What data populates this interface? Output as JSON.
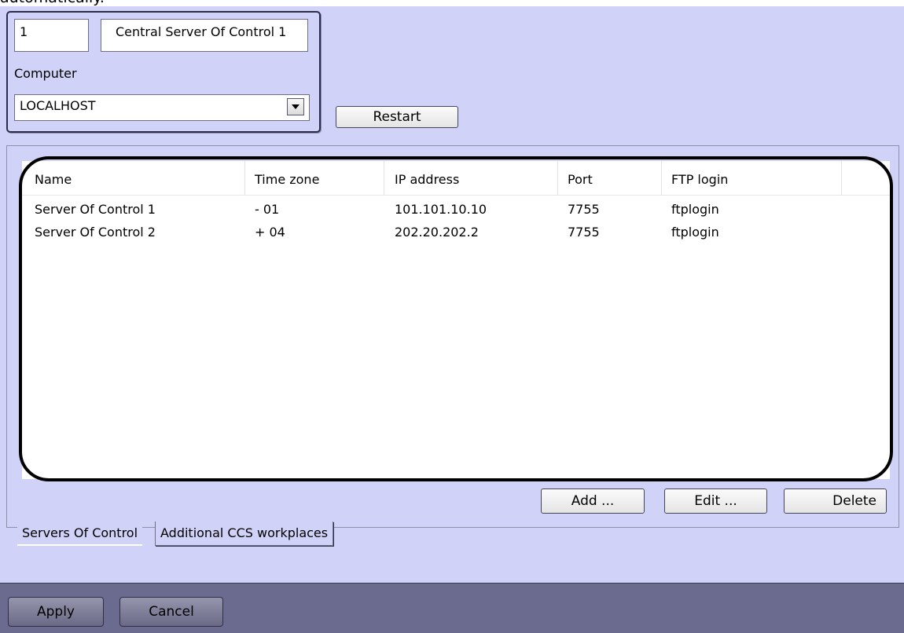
{
  "caption": "automatically.",
  "object": {
    "id": "1",
    "name": "Central Server Of Control 1",
    "computer_label": "Computer",
    "computer_value": "LOCALHOST",
    "restart_label": "Restart"
  },
  "table": {
    "columns": [
      "Name",
      "Time zone",
      "IP address",
      "Port",
      "FTP login"
    ],
    "rows": [
      [
        "Server Of Control 1",
        "- 01",
        "101.101.10.10",
        "7755",
        "ftplogin"
      ],
      [
        "Server Of Control 2",
        "+ 04",
        "202.20.202.2",
        "7755",
        "ftplogin"
      ]
    ]
  },
  "actions": {
    "add": "Add ...",
    "edit": "Edit ...",
    "delete": "Delete"
  },
  "tabs": [
    "Servers Of Control",
    "Additional CCS workplaces"
  ],
  "footer": {
    "apply": "Apply",
    "cancel": "Cancel"
  }
}
